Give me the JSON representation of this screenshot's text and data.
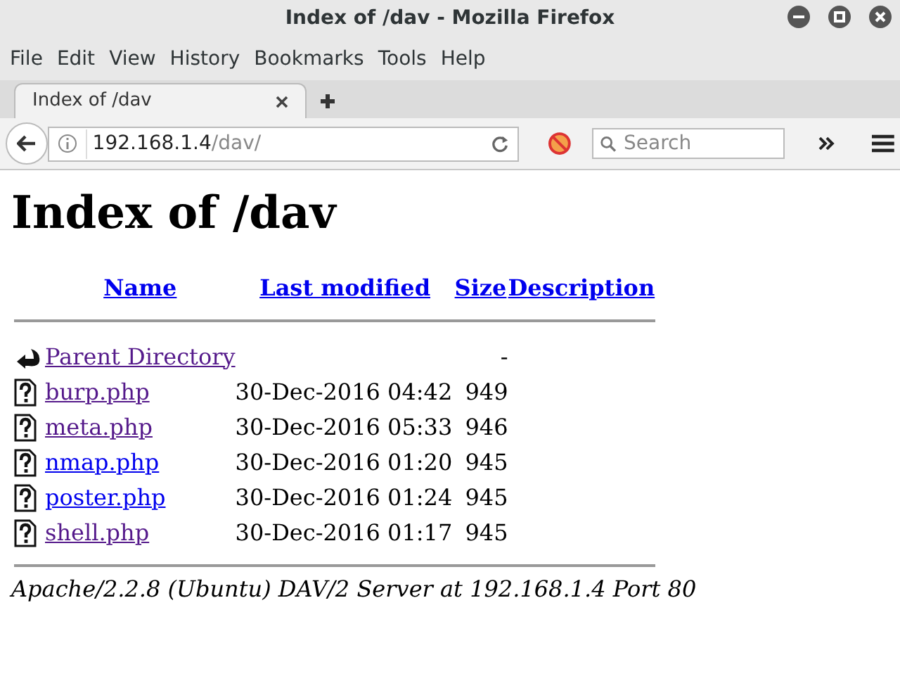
{
  "window": {
    "title": "Index of /dav - Mozilla Firefox"
  },
  "menu": [
    "File",
    "Edit",
    "View",
    "History",
    "Bookmarks",
    "Tools",
    "Help"
  ],
  "tabs": [
    {
      "label": "Index of /dav",
      "selected": true
    }
  ],
  "address": {
    "host": "192.168.1.4",
    "path": "/dav/"
  },
  "search": {
    "placeholder": "Search"
  },
  "page": {
    "heading": "Index of /dav",
    "columns": [
      "Name",
      "Last modified",
      "Size",
      "Description"
    ],
    "rows": [
      {
        "kind": "parent",
        "name": "Parent Directory",
        "modified": "",
        "size": "-",
        "visited": true
      },
      {
        "kind": "file",
        "name": "burp.php",
        "modified": "30-Dec-2016 04:42",
        "size": "949",
        "visited": true
      },
      {
        "kind": "file",
        "name": "meta.php",
        "modified": "30-Dec-2016 05:33",
        "size": "946",
        "visited": true
      },
      {
        "kind": "file",
        "name": "nmap.php",
        "modified": "30-Dec-2016 01:20",
        "size": "945",
        "visited": false
      },
      {
        "kind": "file",
        "name": "poster.php",
        "modified": "30-Dec-2016 01:24",
        "size": "945",
        "visited": false
      },
      {
        "kind": "file",
        "name": "shell.php",
        "modified": "30-Dec-2016 01:17",
        "size": "945",
        "visited": true
      }
    ],
    "footer": "Apache/2.2.8 (Ubuntu) DAV/2 Server at 192.168.1.4 Port 80"
  }
}
